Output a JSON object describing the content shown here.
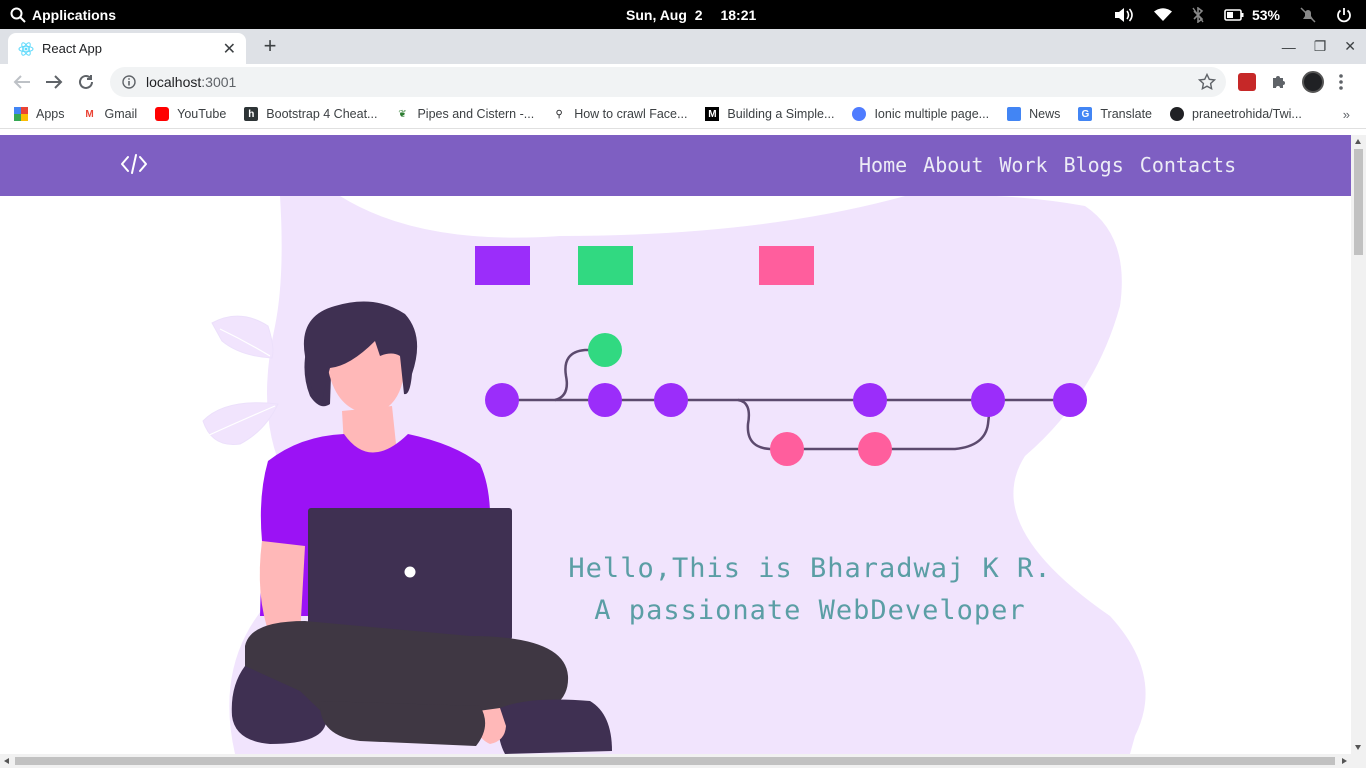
{
  "system": {
    "apps_label": "Applications",
    "date": "Sun, Aug  2",
    "time": "18:21",
    "battery": "53%"
  },
  "browser": {
    "tab_title": "React App",
    "url_host": "localhost",
    "url_port": ":3001",
    "bookmarks": [
      {
        "label": "Apps",
        "icon": "apps-grid-icon"
      },
      {
        "label": "Gmail",
        "icon": "gmail-icon"
      },
      {
        "label": "YouTube",
        "icon": "youtube-icon"
      },
      {
        "label": "Bootstrap 4 Cheat...",
        "icon": "bootstrap-icon"
      },
      {
        "label": "Pipes and Cistern -...",
        "icon": "leaf-icon"
      },
      {
        "label": "How to crawl Face...",
        "icon": "search-icon"
      },
      {
        "label": "Building a Simple...",
        "icon": "medium-icon"
      },
      {
        "label": "Ionic multiple page...",
        "icon": "ionic-icon"
      },
      {
        "label": "News",
        "icon": "news-icon"
      },
      {
        "label": "Translate",
        "icon": "translate-icon"
      },
      {
        "label": "praneetrohida/Twi...",
        "icon": "github-icon"
      }
    ],
    "more_label": "»"
  },
  "page": {
    "logo": "</>",
    "nav": [
      "Home",
      "About",
      "Work",
      "Blogs",
      "Contacts"
    ],
    "hello_line1": "Hello,This is Bharadwaj K R.",
    "hello_line2": "A passionate WebDeveloper"
  },
  "colors": {
    "nav_bg": "#7e5fc2",
    "blob": "#f1e4fd",
    "purple": "#9b2dfa",
    "green": "#31d981",
    "pink": "#ff5e9d",
    "hello_text": "#5b9ea5"
  }
}
